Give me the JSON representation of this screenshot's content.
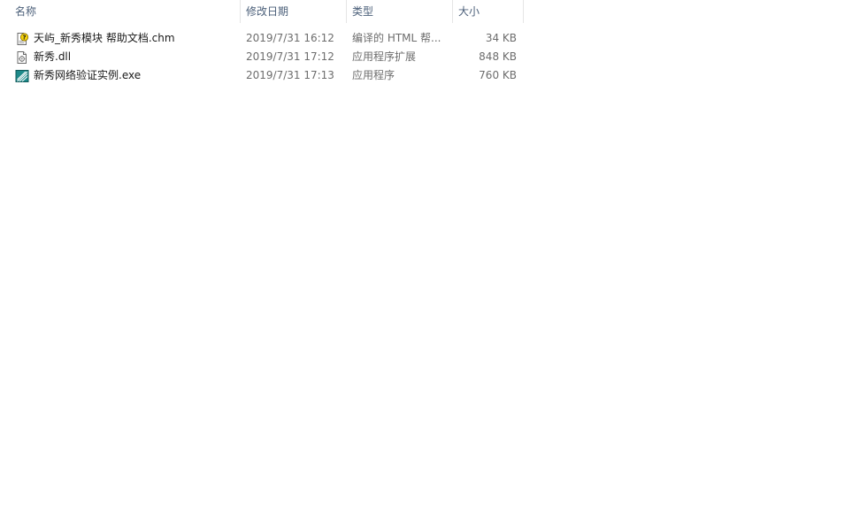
{
  "columns": {
    "name": "名称",
    "modified": "修改日期",
    "type": "类型",
    "size": "大小"
  },
  "sort_indicator": "^",
  "files": [
    {
      "name": "天屿_新秀模块 帮助文档.chm",
      "modified": "2019/7/31 16:12",
      "type": "编译的 HTML 帮...",
      "size": "34 KB",
      "icon": "chm-help-icon"
    },
    {
      "name": "新秀.dll",
      "modified": "2019/7/31 17:12",
      "type": "应用程序扩展",
      "size": "848 KB",
      "icon": "dll-file-icon"
    },
    {
      "name": "新秀网络验证实例.exe",
      "modified": "2019/7/31 17:13",
      "type": "应用程序",
      "size": "760 KB",
      "icon": "exe-app-icon"
    }
  ]
}
